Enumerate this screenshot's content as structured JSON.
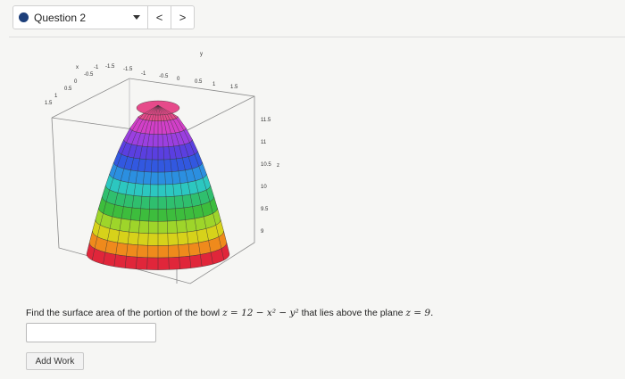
{
  "header": {
    "question_label": "Question 2",
    "prev_symbol": "<",
    "next_symbol": ">"
  },
  "figure": {
    "x_axis_label": "x",
    "y_axis_label": "y",
    "z_axis_label": "z",
    "x_ticks": [
      "1.5",
      "1",
      "0.5",
      "0",
      "-0.5",
      "-1"
    ],
    "y_ticks": [
      "-1.5",
      "-1.5",
      "-1",
      "-0.5",
      "0",
      "0.5",
      "1",
      "1.5"
    ],
    "z_ticks": [
      "11.5",
      "11",
      "10.5",
      "10",
      "9.5",
      "9"
    ],
    "band_colors": [
      "#e0263a",
      "#ef8a1c",
      "#d7d21a",
      "#9ed52a",
      "#3dbd3d",
      "#2fbf6e",
      "#2cc7c0",
      "#2b8fe0",
      "#3258e0",
      "#5a3fe0",
      "#9b3fe0",
      "#d23fc8",
      "#e64a8a"
    ]
  },
  "question": {
    "prefix": "Find the surface area of the portion of the bowl ",
    "equation": "z = 12 − x² − y²",
    "middle": " that lies above the plane ",
    "plane": "z = 9."
  },
  "answer": {
    "value": ""
  },
  "buttons": {
    "add_work": "Add Work"
  }
}
